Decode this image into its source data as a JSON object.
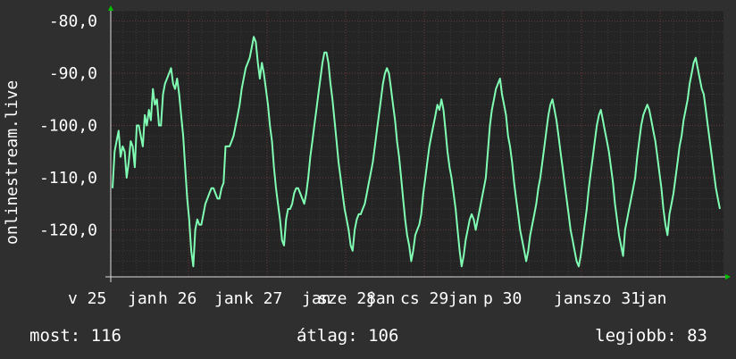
{
  "chart_data": {
    "type": "line",
    "ylabel": "onlinestream.live",
    "ylim": [
      -129,
      -78
    ],
    "yticks": [
      -80,
      -90,
      -100,
      -110,
      -120
    ],
    "ytick_labels": [
      "-80,0",
      "-90,0",
      "-100,0",
      "-110,0",
      "-120,0"
    ],
    "xlim": [
      0,
      690
    ],
    "xticks": [
      {
        "label": "v 25",
        "x": 0
      },
      {
        "label": "jan",
        "x": 12
      },
      {
        "label": "h 26",
        "x": 0
      },
      {
        "label": "jan",
        "x": 12
      },
      {
        "label": "k 27",
        "x": 0
      },
      {
        "label": "jan",
        "x": 12
      },
      {
        "label": "sze 28",
        "x": 0
      },
      {
        "label": "jan",
        "x": 12
      },
      {
        "label": "cs 29",
        "x": 0
      },
      {
        "label": "jan",
        "x": 12
      },
      {
        "label": "p 30",
        "x": 0
      },
      {
        "label": "jan",
        "x": 12
      },
      {
        "label": "szo 31",
        "x": 0
      },
      {
        "label": "jan",
        "x": 12
      }
    ],
    "grid": true,
    "colors": {
      "line": "#80ffb4",
      "background": "#242424",
      "grid_major": "#6a3a3a",
      "grid_minor": "#3a3a3a",
      "axis_arrow": "#00c000"
    },
    "series": [
      {
        "values": [
          -112,
          -105,
          -103,
          -101,
          -106,
          -104,
          -105,
          -110,
          -107,
          -103,
          -104,
          -108,
          -100,
          -100,
          -102,
          -104,
          -98,
          -100,
          -97,
          -99,
          -93,
          -96,
          -95,
          -100,
          -100,
          -94,
          -92,
          -91,
          -90,
          -89,
          -92,
          -93,
          -91,
          -94,
          -98,
          -102,
          -108,
          -114,
          -118,
          -124,
          -127,
          -120,
          -118,
          -119,
          -119,
          -117,
          -115,
          -114,
          -113,
          -112,
          -112,
          -113,
          -114,
          -114,
          -112,
          -111,
          -104,
          -104,
          -104,
          -103,
          -102,
          -100,
          -98,
          -96,
          -93,
          -91,
          -89,
          -88,
          -87,
          -85,
          -83,
          -84,
          -88,
          -91,
          -88,
          -90,
          -93,
          -96,
          -100,
          -103,
          -108,
          -112,
          -115,
          -118,
          -122,
          -123,
          -118,
          -116,
          -116,
          -115,
          -113,
          -112,
          -112,
          -113,
          -114,
          -115,
          -113,
          -110,
          -106,
          -103,
          -100,
          -97,
          -94,
          -91,
          -88,
          -86,
          -86,
          -88,
          -92,
          -95,
          -99,
          -103,
          -107,
          -110,
          -113,
          -116,
          -118,
          -120,
          -123,
          -124,
          -120,
          -118,
          -117,
          -117,
          -116,
          -115,
          -113,
          -111,
          -109,
          -107,
          -104,
          -101,
          -98,
          -95,
          -92,
          -90,
          -89,
          -90,
          -93,
          -96,
          -99,
          -103,
          -106,
          -110,
          -114,
          -118,
          -121,
          -123,
          -126,
          -124,
          -121,
          -120,
          -119,
          -117,
          -113,
          -110,
          -107,
          -104,
          -102,
          -100,
          -98,
          -96,
          -97,
          -95,
          -97,
          -101,
          -105,
          -108,
          -110,
          -113,
          -116,
          -120,
          -124,
          -127,
          -125,
          -122,
          -120,
          -118,
          -117,
          -118,
          -120,
          -118,
          -116,
          -114,
          -112,
          -110,
          -105,
          -100,
          -97,
          -95,
          -93,
          -92,
          -91,
          -94,
          -96,
          -98,
          -102,
          -104,
          -107,
          -111,
          -114,
          -117,
          -120,
          -122,
          -124,
          -126,
          -124,
          -121,
          -119,
          -117,
          -115,
          -112,
          -110,
          -107,
          -104,
          -101,
          -98,
          -96,
          -95,
          -97,
          -99,
          -102,
          -105,
          -108,
          -111,
          -114,
          -117,
          -120,
          -122,
          -124,
          -126,
          -127,
          -125,
          -122,
          -119,
          -116,
          -112,
          -109,
          -106,
          -103,
          -100,
          -98,
          -97,
          -99,
          -101,
          -103,
          -105,
          -108,
          -111,
          -115,
          -118,
          -121,
          -123,
          -125,
          -120,
          -118,
          -116,
          -114,
          -112,
          -110,
          -106,
          -103,
          -100,
          -98,
          -97,
          -96,
          -97,
          -99,
          -101,
          -103,
          -106,
          -109,
          -112,
          -116,
          -119,
          -121,
          -117,
          -115,
          -113,
          -110,
          -107,
          -104,
          -102,
          -99,
          -97,
          -95,
          -92,
          -90,
          -88,
          -87,
          -89,
          -91,
          -93,
          -94,
          -97,
          -100,
          -103,
          -106,
          -109,
          -112,
          -114,
          -116
        ]
      }
    ]
  },
  "footer": {
    "now": "most: 116",
    "avg": "átlag: 106",
    "best": "legjobb: 83"
  }
}
